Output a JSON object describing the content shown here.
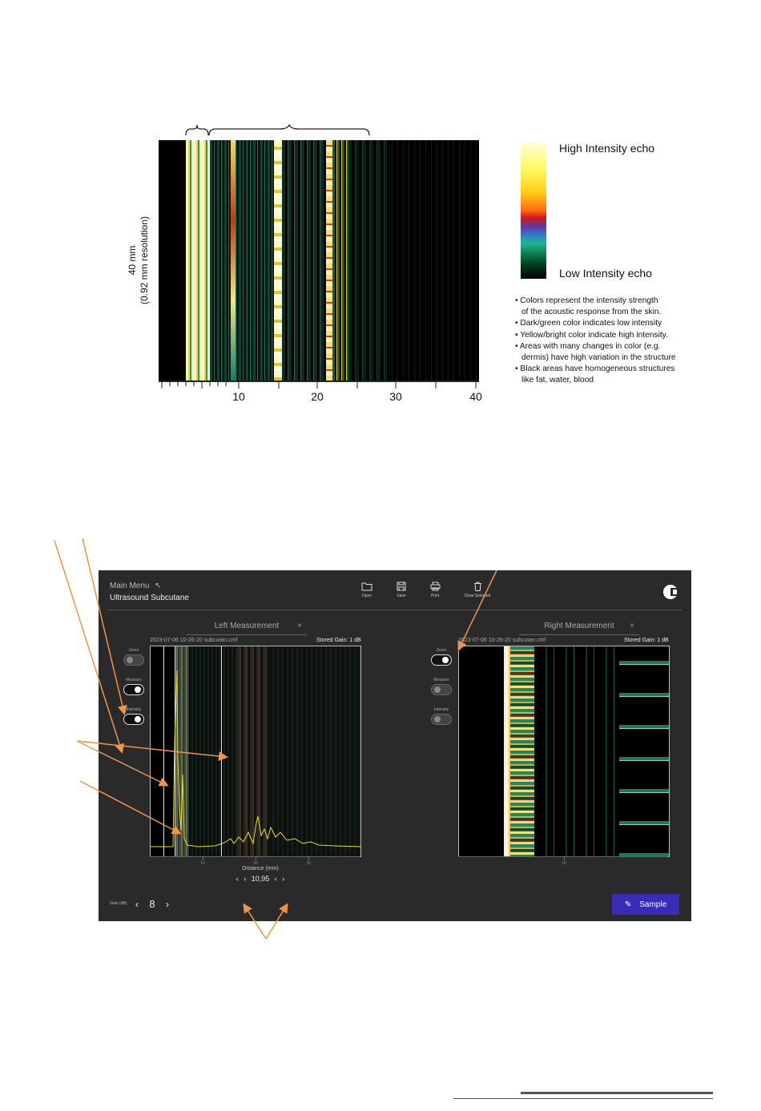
{
  "figure": {
    "y_axis_label_line1": "40 mm",
    "y_axis_label_line2": "(0.92 mm resolution)",
    "x_ticks": [
      "10",
      "20",
      "30",
      "40"
    ],
    "colorbar_high_label": "High Intensity echo",
    "colorbar_low_label": "Low Intensity echo",
    "notes": [
      "• Colors represent the intensity strength",
      "  of the acoustic response from the skin.",
      "• Dark/green color indicates low intensity",
      "• Yellow/bright color indicate high intensity.",
      "• Areas with many changes in color  (e.g.",
      "  dermis) have high variation in the structure",
      "• Black areas have homogeneous structures",
      "  like fat, water, blood"
    ]
  },
  "app": {
    "main_menu": "Main Menu",
    "title": "Ultrasound Subcutane",
    "toolbar": {
      "open": "Open",
      "save": "Save",
      "print": "Print",
      "clear": "Clear Selected"
    },
    "left": {
      "tab_label": "Left Measurement",
      "timestamp": "2023-07-06 10-26-20",
      "filename": "subcutan.cmf",
      "stored_gain": "Stored Gain: 1 dB",
      "toggles": {
        "zoom": "Zoom",
        "measure": "Measure",
        "intensity": "Intensity"
      },
      "axis_ticks": [
        "10",
        "20",
        "30"
      ],
      "distance_label": "Distance (mm)",
      "distance_value": "10,95"
    },
    "right": {
      "tab_label": "Right Measurement",
      "timestamp": "2023-07-06 10-26-20",
      "filename": "subcutan.cmf",
      "stored_gain": "Stored Gain: 1 dB",
      "toggles": {
        "zoom": "Zoom",
        "measure": "Measure",
        "intensity": "Intensity"
      },
      "axis_ticks": [
        "10"
      ]
    },
    "gain": {
      "label": "Gain (dB)",
      "value": "8"
    },
    "sample_button": "Sample",
    "colors": {
      "accent": "#3a2cb8",
      "annotation": "#f0944a",
      "background": "#2a2a2a"
    }
  }
}
